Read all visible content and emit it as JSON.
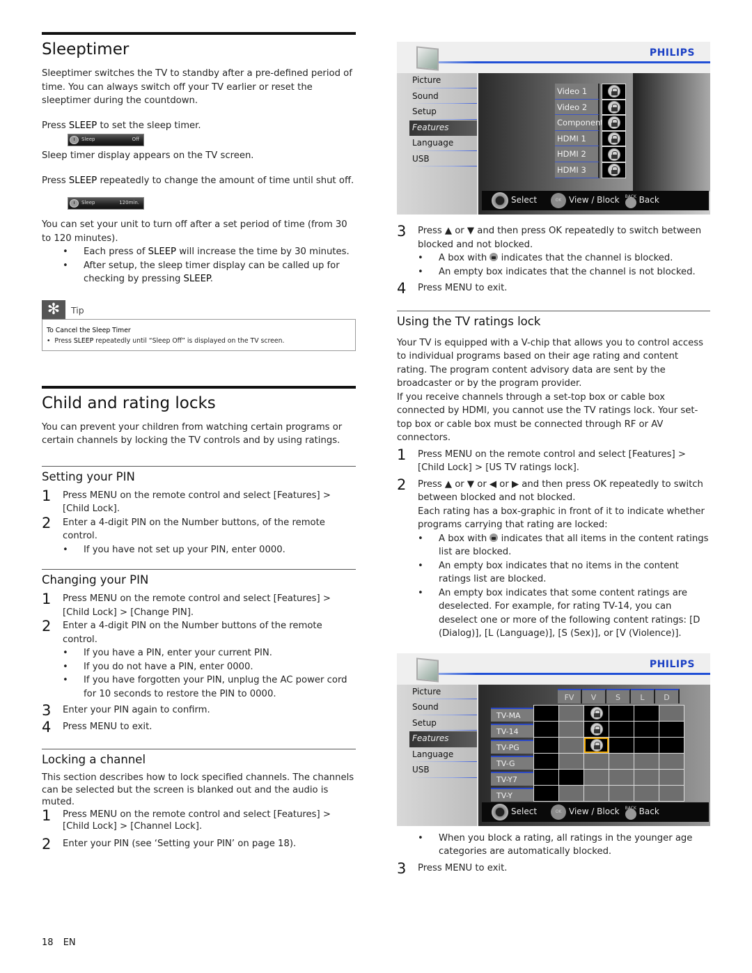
{
  "page": {
    "number": "18",
    "lang": "EN"
  },
  "sleeptimer": {
    "title": "Sleeptimer",
    "intro": "Sleeptimer switches the TV to standby after a pre-defined period of time. You can always switch off your TV earlier or reset the sleeptimer during the countdown.",
    "press_sleep_pre": "Press ",
    "press_sleep_key": "SLEEP",
    "press_sleep_post": " to set the sleep timer.",
    "osd1": {
      "label": "Sleep",
      "value": "Off"
    },
    "display_appears": "Sleep timer display appears on the TV screen.",
    "repeat_pre": "Press ",
    "repeat_key": "SLEEP",
    "repeat_post": " repeatedly to change the amount of time until shut off.",
    "osd2": {
      "label": "Sleep",
      "value": "120min."
    },
    "range_text": "You can set your unit to turn off after a set period of time (from 30 to 120 minutes).",
    "bullets": [
      {
        "pre": "Each press of ",
        "key": "SLEEP",
        "post": " will increase the time by 30 minutes."
      },
      {
        "pre": "After setup, the sleep timer display can be called up for checking by pressing ",
        "key": "SLEEP",
        "post": "."
      }
    ],
    "tip": {
      "label": "Tip",
      "heading": "To Cancel the Sleep Timer",
      "bullet_pre": "Press ",
      "bullet_key": "SLEEP",
      "bullet_post": " repeatedly until “Sleep Off” is displayed on the TV screen."
    }
  },
  "child_locks": {
    "title": "Child and rating locks",
    "intro": "You can prevent your children from watching certain programs or certain channels by locking the TV controls and by using ratings.",
    "setting_pin": {
      "title": "Setting your PIN",
      "steps": [
        {
          "num": "1",
          "text": "Press MENU on the remote control and select [Features] > [Child Lock]."
        },
        {
          "num": "2",
          "text": "Enter a 4-digit PIN on the Number buttons, of the remote control."
        }
      ],
      "bullets": [
        "If you have not set up your PIN, enter 0000."
      ]
    },
    "changing_pin": {
      "title": "Changing your PIN",
      "steps": [
        {
          "num": "1",
          "text": "Press MENU on the remote control and select [Features] > [Child Lock] > [Change PIN]."
        },
        {
          "num": "2",
          "text": "Enter a 4-digit PIN on the Number buttons of the remote control."
        },
        {
          "num": "3",
          "text": "Enter your PIN again to confirm."
        },
        {
          "num": "4",
          "text": "Press MENU to exit."
        }
      ],
      "bullets": [
        "If you have a PIN, enter your current PIN.",
        "If you do not have a PIN, enter 0000.",
        "If you have forgotten your PIN, unplug the AC power cord for 10 seconds to restore the PIN to 0000."
      ]
    },
    "locking_channel": {
      "title": "Locking a channel",
      "intro": "This section describes how to lock specified channels. The channels can be selected but the screen is blanked out and the audio is muted.",
      "steps": [
        {
          "num": "1",
          "text": "Press MENU on the remote control and select [Features] > [Child Lock] > [Channel Lock]."
        },
        {
          "num": "2",
          "text": "Enter your PIN (see ‘Setting your PIN’ on page 18)."
        },
        {
          "num": "3",
          "text": "Press ▲ or ▼ and then press OK repeatedly to switch between blocked and not blocked."
        },
        {
          "num": "4",
          "text": "Press MENU to exit."
        }
      ],
      "bullets": [
        {
          "pre": "A box with ",
          "post": " indicates that the channel is blocked."
        },
        {
          "pre": "An empty box indicates that the channel is not blocked.",
          "post": ""
        }
      ]
    },
    "ratings_lock": {
      "title": "Using the TV ratings lock",
      "intro1": "Your TV is equipped with a V-chip that allows you to control access to individual programs based on their age rating and content rating. The program content advisory data are sent by the broadcaster or by the program provider.",
      "intro2": "If you receive channels through a set-top box or cable box connected by HDMI, you cannot use the TV ratings lock. Your set-top box or cable box must be connected through RF or AV connectors.",
      "steps": [
        {
          "num": "1",
          "text": "Press MENU on the remote control and select [Features] > [Child Lock] > [US TV ratings lock]."
        },
        {
          "num": "2",
          "text": "Press ▲ or ▼ or ◀ or ▶ and then press OK repeatedly to switch between blocked and not blocked."
        },
        {
          "num": "3",
          "text": "Press MENU to exit."
        }
      ],
      "step2_extra": "Each rating has a box-graphic in front of it to indicate whether programs carrying that rating are locked:",
      "bullets": [
        {
          "pre": "A box with ",
          "post": " indicates that all items in the content ratings list are blocked."
        },
        {
          "pre": "An empty box indicates that no items in the content ratings list are blocked.",
          "post": ""
        },
        {
          "pre": "An empty box indicates that some content ratings are deselected. For example, for rating TV-14, you can deselect one or more of the following content ratings: [D (Dialog)], [L (Language)], [S (Sex)], or [V (Violence)].",
          "post": ""
        }
      ],
      "after_bullet": "When you block a rating, all ratings in the younger age categories are automatically blocked."
    }
  },
  "osd_common": {
    "brand": "PHILIPS",
    "menu": [
      "Picture",
      "Sound",
      "Setup",
      "Features",
      "Language",
      "USB"
    ],
    "active_menu": "Features",
    "footer": {
      "select": "Select",
      "ok": "OK",
      "view_block": "View / Block",
      "back_small": "BACK",
      "back": "Back"
    }
  },
  "channel_osd": {
    "channels": [
      {
        "name": "Video 1",
        "locked": true
      },
      {
        "name": "Video 2",
        "locked": true
      },
      {
        "name": "Component",
        "locked": true
      },
      {
        "name": "HDMI 1",
        "locked": true
      },
      {
        "name": "HDMI 2",
        "locked": true
      },
      {
        "name": "HDMI 3",
        "locked": true
      }
    ]
  },
  "ratings_osd": {
    "columns": [
      "FV",
      "V",
      "S",
      "L",
      "D"
    ],
    "ratings": [
      "TV-MA",
      "TV-14",
      "TV-PG",
      "TV-G",
      "TV-Y7",
      "TV-Y"
    ],
    "grid": [
      [
        "black",
        "gray",
        "lock",
        "black",
        "black",
        "gray"
      ],
      [
        "black",
        "gray",
        "lock",
        "black",
        "black",
        "black"
      ],
      [
        "black",
        "gray",
        "lock-selected",
        "black",
        "black",
        "black"
      ],
      [
        "black",
        "gray",
        "gray",
        "gray",
        "gray",
        "gray"
      ],
      [
        "black",
        "black",
        "gray",
        "gray",
        "gray",
        "gray"
      ],
      [
        "black",
        "gray",
        "gray",
        "gray",
        "gray",
        "gray"
      ]
    ]
  }
}
